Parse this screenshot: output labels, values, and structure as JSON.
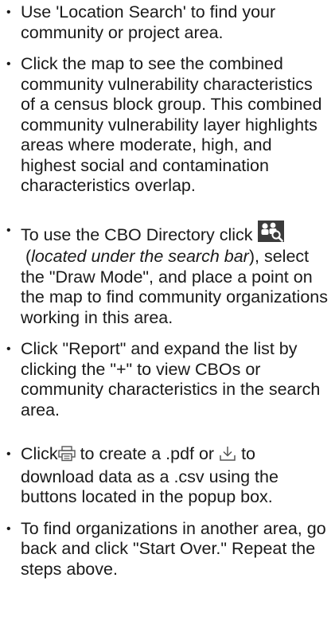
{
  "steps": [
    {
      "text": "Use 'Location Search' to find your community or project area."
    },
    {
      "text": "Click the map to see the combined community vulnerability characteristics of a census block group. This combined community vulnerability layer highlights areas where moderate, high, and highest social and contamination characteristics overlap."
    },
    {
      "text_before_icon": "To use the CBO Directory click",
      "icon": "cbo-directory-people-search-icon",
      "text_italic": "located under the search bar",
      "text_after": "select the \"Draw Mode\", and place a point on the map to find community organizations working in this area."
    },
    {
      "text": "Click \"Report\" and expand the list by clicking the \"+\" to view CBOs or community characteristics in the search area."
    },
    {
      "text_start": "Click",
      "print_icon": "print-icon",
      "text_middle": "to create a .pdf or",
      "download_icon": "download-icon",
      "text_end": "to download data as a .csv using the buttons located in the popup box."
    },
    {
      "text": "To find organizations in another area, go back and click \"Start Over.\" Repeat the steps above."
    }
  ]
}
